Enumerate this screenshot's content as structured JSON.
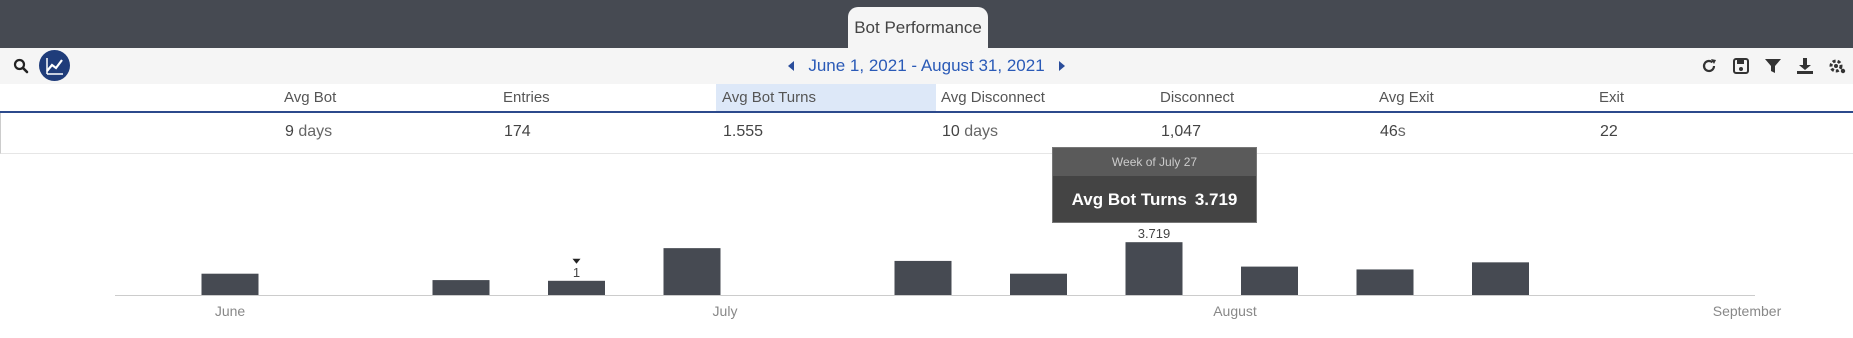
{
  "tab": {
    "label": "Bot Performance"
  },
  "toolbar": {
    "date_range": "June 1, 2021 - August 31, 2021",
    "icons": [
      "refresh-icon",
      "save-icon",
      "filter-icon",
      "download-icon",
      "settings-icon"
    ]
  },
  "metrics": [
    {
      "label": "Avg Bot",
      "value": "9",
      "unit": " days"
    },
    {
      "label": "Entries",
      "value": "174",
      "unit": ""
    },
    {
      "label": "Avg Bot Turns",
      "value": "1.555",
      "unit": "",
      "active": true
    },
    {
      "label": "Avg Disconnect",
      "value": "10",
      "unit": " days"
    },
    {
      "label": "Disconnect",
      "value": "1,047",
      "unit": ""
    },
    {
      "label": "Avg Exit",
      "value": "46",
      "unit": "s"
    },
    {
      "label": "Exit",
      "value": "22",
      "unit": ""
    }
  ],
  "tooltip": {
    "title": "Week of July 27",
    "metric": "Avg Bot Turns",
    "value": "3.719"
  },
  "chart_data": {
    "type": "bar",
    "series_name": "Avg Bot Turns",
    "x_ticks": [
      "June",
      "July",
      "August",
      "September"
    ],
    "bars": [
      {
        "index": 0,
        "value": 1.5
      },
      {
        "index": 2,
        "value": 1.05
      },
      {
        "index": 3,
        "value": 1.0,
        "label": "1",
        "marker": true
      },
      {
        "index": 4,
        "value": 3.3
      },
      {
        "index": 6,
        "value": 2.4
      },
      {
        "index": 7,
        "value": 1.5
      },
      {
        "index": 8,
        "value": 3.719,
        "label": "3.719"
      },
      {
        "index": 9,
        "value": 2.0
      },
      {
        "index": 10,
        "value": 1.8
      },
      {
        "index": 11,
        "value": 2.3
      }
    ],
    "colors": {
      "bar": "#464a52",
      "axis": "#cccccc",
      "tick_text": "#888888"
    }
  }
}
